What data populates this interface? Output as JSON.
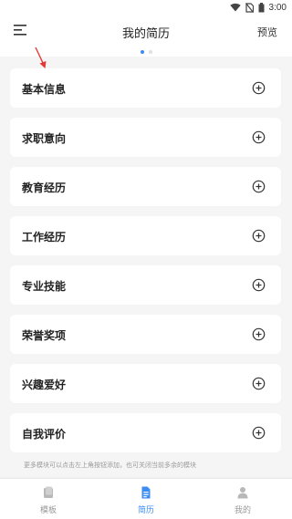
{
  "status_bar": {
    "time": "3:00"
  },
  "header": {
    "menu_icon": "menu-icon",
    "title": "我的简历",
    "preview_label": "预览"
  },
  "pager": {
    "count": 2,
    "active_index": 0
  },
  "sections": [
    {
      "label": "基本信息",
      "icon": "add-circle-icon"
    },
    {
      "label": "求职意向",
      "icon": "add-circle-icon"
    },
    {
      "label": "教育经历",
      "icon": "add-circle-icon"
    },
    {
      "label": "工作经历",
      "icon": "add-circle-icon"
    },
    {
      "label": "专业技能",
      "icon": "add-circle-icon"
    },
    {
      "label": "荣誉奖项",
      "icon": "add-circle-icon"
    },
    {
      "label": "兴趣爱好",
      "icon": "add-circle-icon"
    },
    {
      "label": "自我评价",
      "icon": "add-circle-icon"
    }
  ],
  "hint": "更多模块可以点击左上角按钮添加，也可关闭当前多余的模块",
  "bottom_nav": [
    {
      "label": "模板",
      "icon": "template-icon",
      "active": false
    },
    {
      "label": "简历",
      "icon": "resume-document-icon",
      "active": true
    },
    {
      "label": "我的",
      "icon": "user-profile-icon",
      "active": false
    }
  ],
  "colors": {
    "accent": "#3b8cf5",
    "annotation_arrow": "#e53935"
  }
}
